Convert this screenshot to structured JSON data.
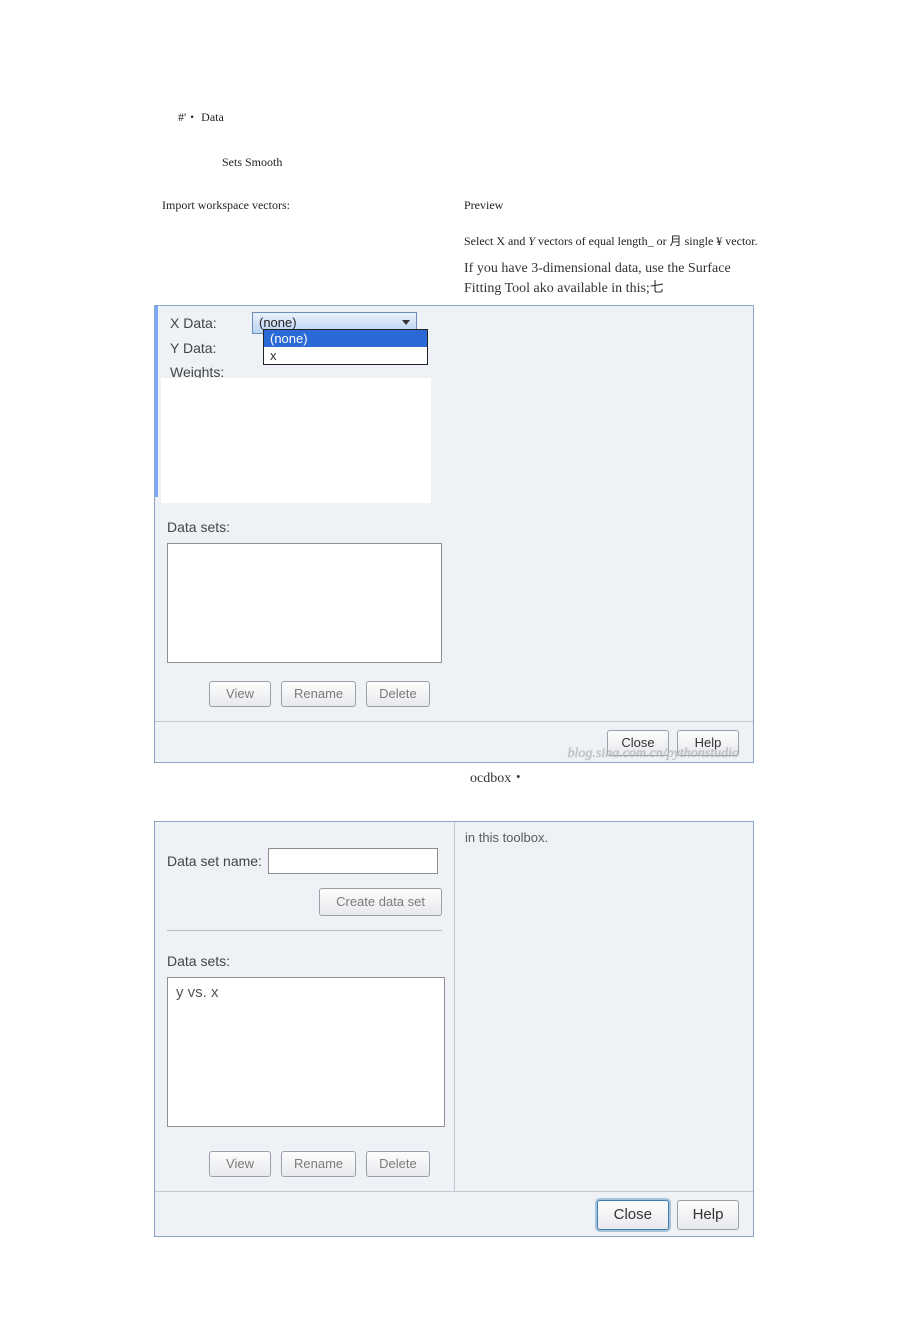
{
  "header": {
    "title_line": "#'・ Data",
    "subtitle_line": "Sets Smooth"
  },
  "left_side": {
    "import_label": "Import workspace vectors:"
  },
  "right_side": {
    "preview_label": "Preview",
    "help_line_1": "Select X and ",
    "help_line_1_italic": "Y",
    "help_line_1_tail": " vectors of equal length_ or 月 single ¥ vector.",
    "help_line_2": "If you have 3-dimensional data, use the Surface Fitting Tool ako available in this;七"
  },
  "dialog1": {
    "x_label": "X Data:",
    "y_label": "Y Data:",
    "w_label": "Weights:",
    "x_value": "(none)",
    "dd_selected": "(none)",
    "dd_alt": "x",
    "sets_label": "Data sets:",
    "view_btn": "View",
    "rename_btn": "Rename",
    "delete_btn": "Delete",
    "close_btn": "Close",
    "help_btn": "Help",
    "watermark": "blog.sina.com.cn/pythonstudio"
  },
  "below_note": "ocdbox・",
  "dialog2": {
    "toolbox_text": "in this toolbox.",
    "dsn_label": "Data set name:",
    "dsn_value": "",
    "create_btn": "Create data set",
    "sets_label": "Data sets:",
    "list_item": "y vs. x",
    "view_btn": "View",
    "rename_btn": "Rename",
    "delete_btn": "Delete",
    "close_btn": "Close",
    "help_btn": "Help"
  }
}
